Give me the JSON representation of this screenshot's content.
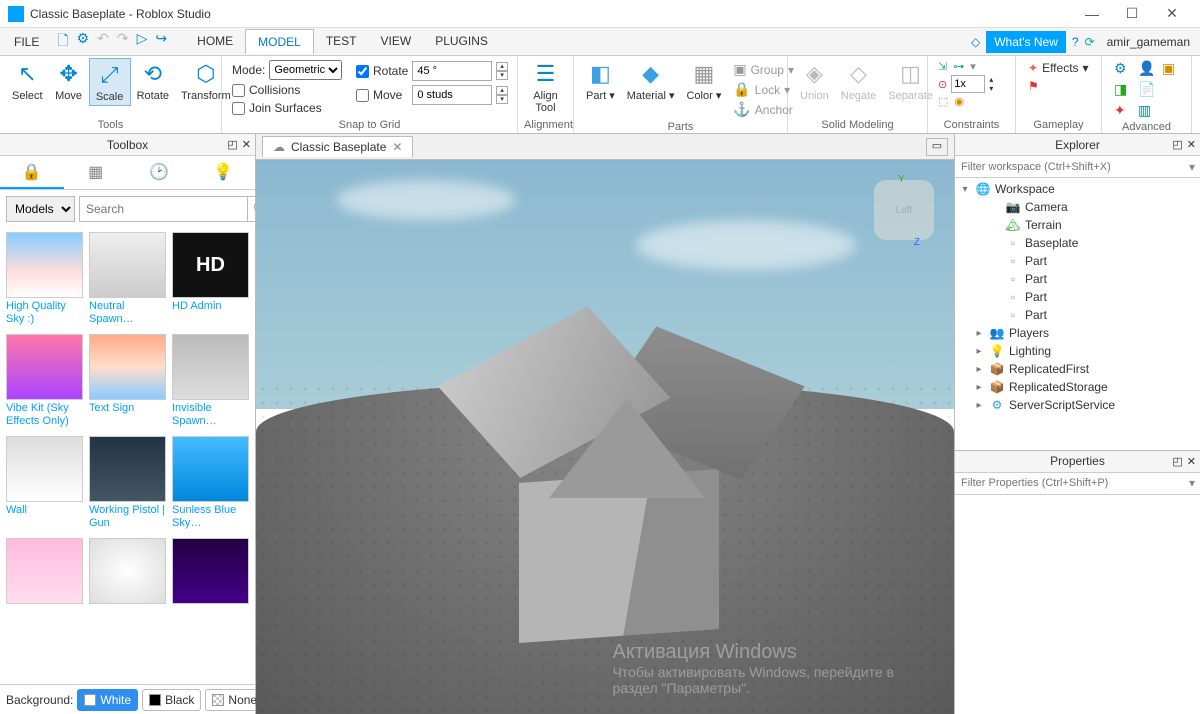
{
  "window": {
    "title": "Classic Baseplate - Roblox Studio"
  },
  "menubar": {
    "file": "FILE",
    "tabs": [
      "HOME",
      "MODEL",
      "TEST",
      "VIEW",
      "PLUGINS"
    ],
    "active_tab": "MODEL",
    "whatsnew": "What's New",
    "user": "amir_gameman"
  },
  "ribbon": {
    "tools": {
      "label": "Tools",
      "buttons": [
        "Select",
        "Move",
        "Scale",
        "Rotate",
        "Transform"
      ],
      "active": "Scale"
    },
    "snap": {
      "mode_label": "Mode:",
      "mode_value": "Geometric",
      "collisions": "Collisions",
      "join": "Join Surfaces",
      "rotate_label": "Rotate",
      "rotate_value": "45 °",
      "move_label": "Move",
      "move_value": "0 studs",
      "label": "Snap to Grid"
    },
    "alignment": {
      "label": "Alignment",
      "btn": "Align\nTool"
    },
    "parts": {
      "label": "Parts",
      "part": "Part",
      "material": "Material",
      "color": "Color",
      "group": "Group",
      "lock": "Lock",
      "anchor": "Anchor"
    },
    "solid": {
      "label": "Solid Modeling",
      "union": "Union",
      "negate": "Negate",
      "separate": "Separate"
    },
    "constraints": {
      "label": "Constraints",
      "scale": "1x"
    },
    "gameplay": {
      "label": "Gameplay",
      "effects": "Effects"
    },
    "advanced": {
      "label": "Advanced"
    }
  },
  "toolbox": {
    "title": "Toolbox",
    "dropdown": "Models",
    "search_placeholder": "Search",
    "items": [
      "High Quality Sky :)",
      "Neutral Spawn…",
      "HD Admin",
      "Vibe Kit (Sky Effects Only)",
      "Text Sign",
      "Invisible Spawn…",
      "Wall",
      "Working Pistol | Gun",
      "Sunless Blue Sky…",
      "",
      "",
      ""
    ],
    "bg_label": "Background:",
    "bg_options": [
      "White",
      "Black",
      "None"
    ]
  },
  "viewport": {
    "tab": "Classic Baseplate"
  },
  "explorer": {
    "title": "Explorer",
    "filter": "Filter workspace (Ctrl+Shift+X)",
    "root": "Workspace",
    "children": [
      "Camera",
      "Terrain",
      "Baseplate",
      "Part",
      "Part",
      "Part",
      "Part"
    ],
    "services": [
      "Players",
      "Lighting",
      "ReplicatedFirst",
      "ReplicatedStorage",
      "ServerScriptService"
    ]
  },
  "properties": {
    "title": "Properties",
    "filter": "Filter Properties (Ctrl+Shift+P)"
  },
  "watermark": {
    "l1": "Активация Windows",
    "l2": "Чтобы активировать Windows, перейдите в",
    "l3": "раздел \"Параметры\"."
  }
}
